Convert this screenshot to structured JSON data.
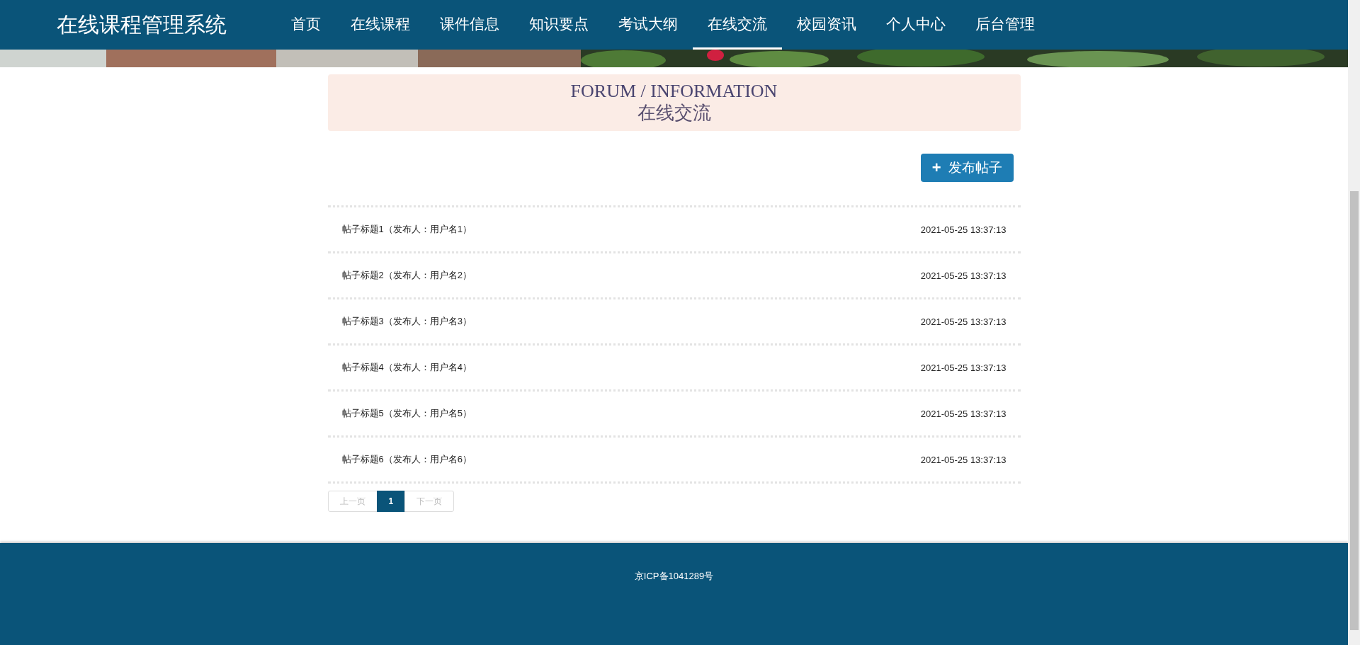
{
  "site_title": "在线课程管理系统",
  "nav": [
    {
      "label": "首页",
      "selected": false
    },
    {
      "label": "在线课程",
      "selected": false
    },
    {
      "label": "课件信息",
      "selected": false
    },
    {
      "label": "知识要点",
      "selected": false
    },
    {
      "label": "考试大纲",
      "selected": false
    },
    {
      "label": "在线交流",
      "selected": true
    },
    {
      "label": "校园资讯",
      "selected": false
    },
    {
      "label": "个人中心",
      "selected": false
    },
    {
      "label": "后台管理",
      "selected": false
    }
  ],
  "section_header": {
    "title_en": "FORUM / INFORMATION",
    "title_cn": "在线交流"
  },
  "post_button": {
    "icon": "+",
    "label": "发布帖子"
  },
  "posts": [
    {
      "title": "帖子标题1（发布人：用户名1）",
      "time": "2021-05-25 13:37:13"
    },
    {
      "title": "帖子标题2（发布人：用户名2）",
      "time": "2021-05-25 13:37:13"
    },
    {
      "title": "帖子标题3（发布人：用户名3）",
      "time": "2021-05-25 13:37:13"
    },
    {
      "title": "帖子标题4（发布人：用户名4）",
      "time": "2021-05-25 13:37:13"
    },
    {
      "title": "帖子标题5（发布人：用户名5）",
      "time": "2021-05-25 13:37:13"
    },
    {
      "title": "帖子标题6（发布人：用户名6）",
      "time": "2021-05-25 13:37:13"
    }
  ],
  "pagination": [
    {
      "label": "上一页",
      "disabled": true,
      "selected": false
    },
    {
      "label": "1",
      "disabled": false,
      "selected": true
    },
    {
      "label": "下一页",
      "disabled": true,
      "selected": false
    }
  ],
  "footer": {
    "text": "京ICP备1041289号"
  }
}
